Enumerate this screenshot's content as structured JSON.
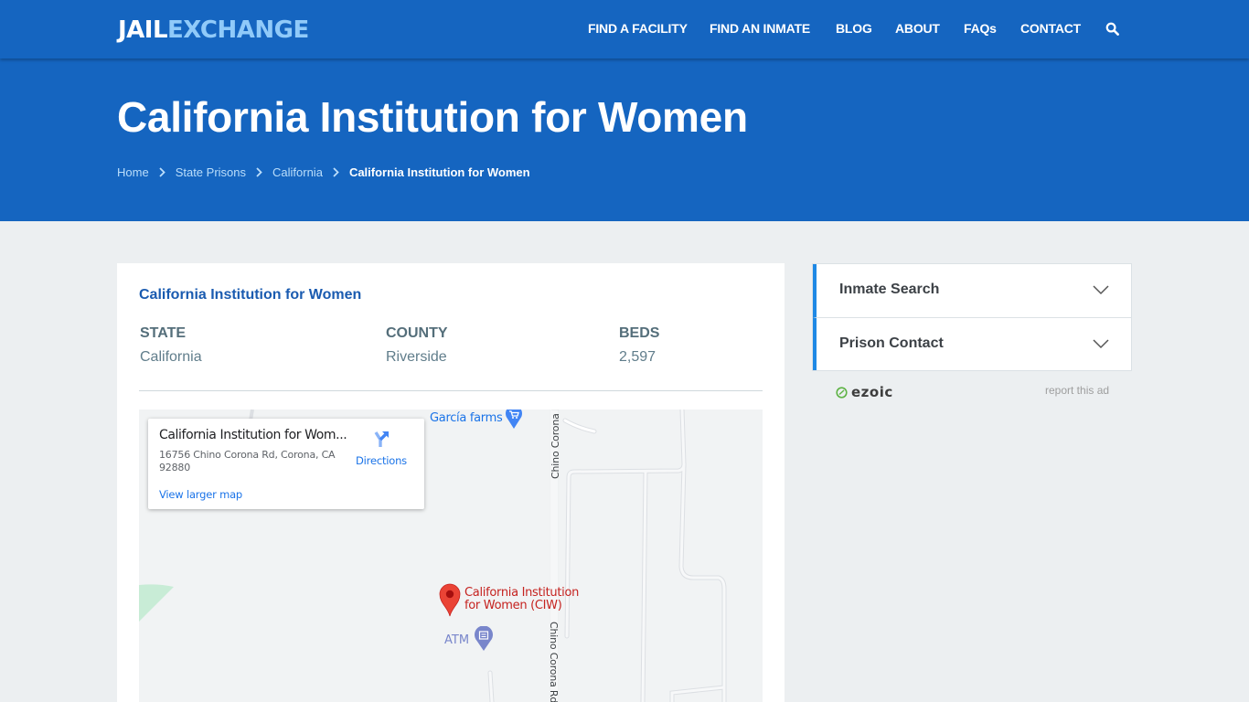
{
  "header": {
    "logo_part1": "JAIL",
    "logo_part2": "EXCHANGE",
    "nav": [
      {
        "label": "FIND A FACILITY"
      },
      {
        "label": "FIND AN INMATE"
      },
      {
        "label": "BLOG"
      },
      {
        "label": "ABOUT"
      },
      {
        "label": "FAQs"
      },
      {
        "label": "CONTACT"
      }
    ],
    "search_icon": "search-icon"
  },
  "hero": {
    "title": "California Institution for Women",
    "breadcrumb": [
      {
        "label": "Home"
      },
      {
        "label": "State Prisons"
      },
      {
        "label": "California"
      },
      {
        "label": "California Institution for Women"
      }
    ]
  },
  "facility": {
    "name": "California Institution for Women",
    "stats": [
      {
        "label": "STATE",
        "value": "California"
      },
      {
        "label": "COUNTY",
        "value": "Riverside"
      },
      {
        "label": "BEDS",
        "value": "2,597"
      }
    ]
  },
  "map": {
    "info_title": "California Institution for Wom...",
    "info_address": "16756 Chino Corona Rd, Corona, CA 92880",
    "directions_label": "Directions",
    "view_larger_label": "View larger map",
    "poi_garcia": "García farms",
    "poi_ciw_line1": "California Institution",
    "poi_ciw_line2": "for Women (CIW)",
    "poi_atm": "ATM",
    "road_top": "Chino Corona I",
    "road_bottom": "Chino Corona Rd",
    "colors": {
      "pin": "#ea4335",
      "poi_blue": "#4285f4",
      "atm": "#7986cb",
      "park": "#c8ecd6"
    }
  },
  "sidebar": {
    "accordion": [
      {
        "label": "Inmate Search"
      },
      {
        "label": "Prison Contact"
      }
    ],
    "ad_brand": "ezoic",
    "report_ad": "report this ad"
  },
  "colors": {
    "brand_blue": "#1565c0",
    "logo_accent": "#90caf9",
    "accordion_accent": "#1e88e5",
    "page_bg": "#eceff1"
  }
}
